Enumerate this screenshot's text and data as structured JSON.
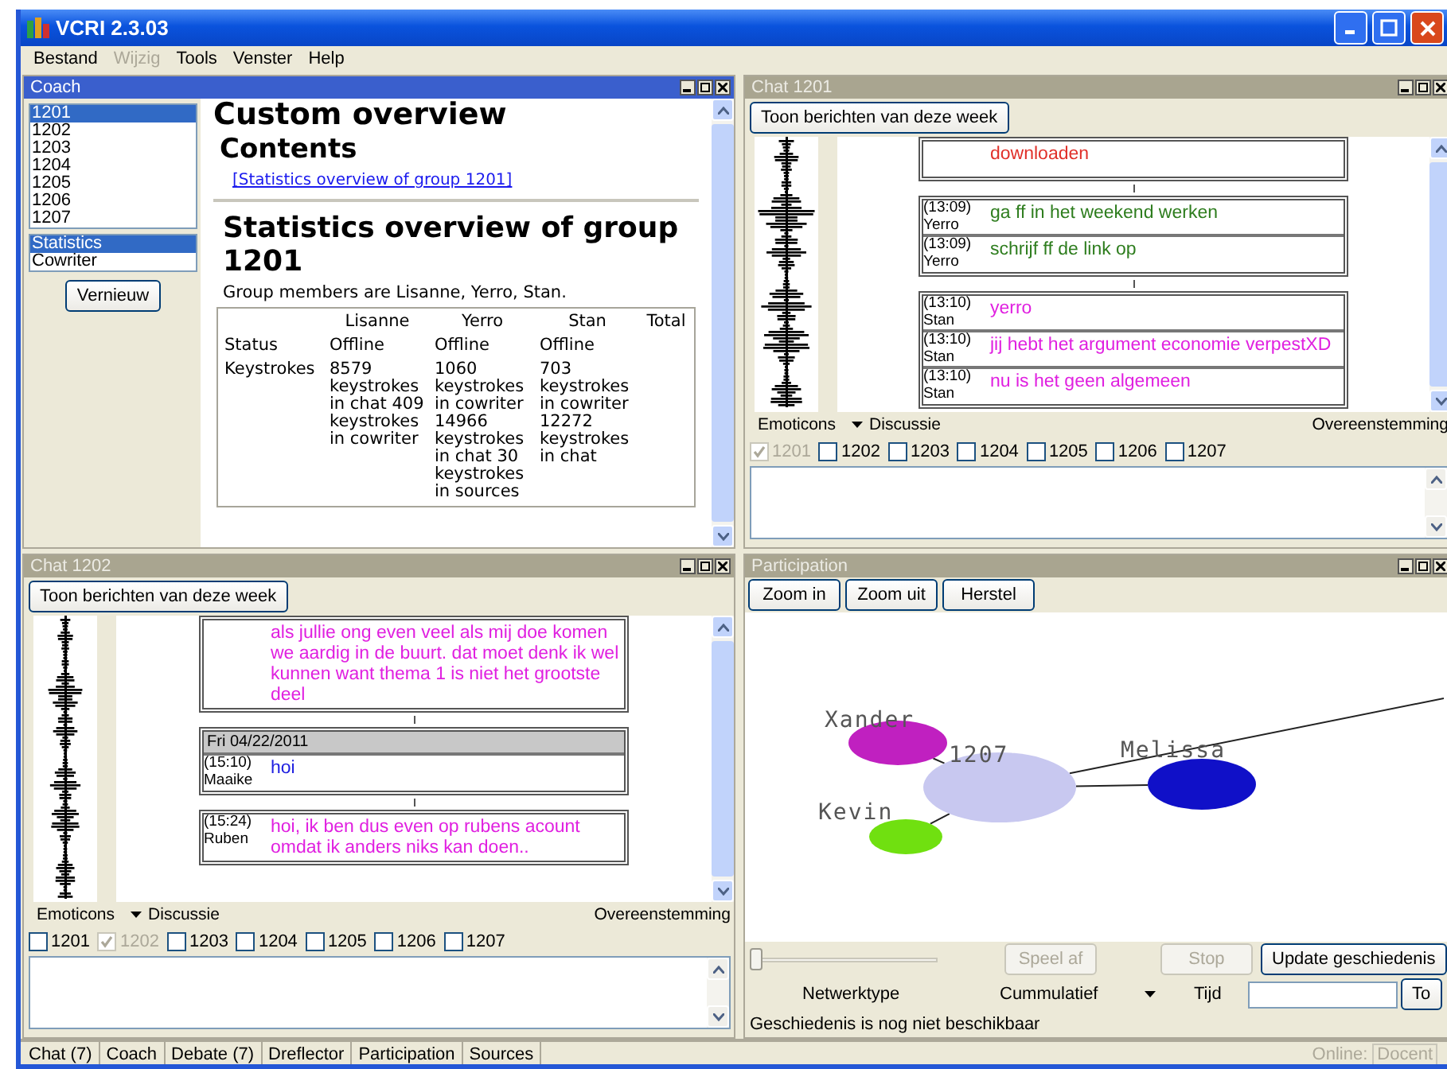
{
  "window": {
    "title": "VCRI 2.3.03"
  },
  "menu": [
    {
      "label": "Bestand",
      "disabled": false
    },
    {
      "label": "Wijzig",
      "disabled": true
    },
    {
      "label": "Tools",
      "disabled": false
    },
    {
      "label": "Venster",
      "disabled": false
    },
    {
      "label": "Help",
      "disabled": false
    }
  ],
  "coach": {
    "title": "Coach",
    "active": true,
    "groups": [
      {
        "label": "1201",
        "selected": true
      },
      {
        "label": "1202",
        "selected": false
      },
      {
        "label": "1203",
        "selected": false
      },
      {
        "label": "1204",
        "selected": false
      },
      {
        "label": "1205",
        "selected": false
      },
      {
        "label": "1206",
        "selected": false
      },
      {
        "label": "1207",
        "selected": false
      }
    ],
    "views": [
      {
        "label": "Statistics",
        "selected": true
      },
      {
        "label": "Cowriter",
        "selected": false
      }
    ],
    "refresh_button": "Vernieuw",
    "report": {
      "heading": "Custom overview",
      "contents_heading": "Contents",
      "link": "[Statistics overview of group 1201]",
      "section_heading": "Statistics overview of group 1201",
      "members": "Group members are Lisanne, Yerro, Stan.",
      "columns": [
        "Lisanne",
        "Yerro",
        "Stan",
        "Total"
      ],
      "rows": [
        {
          "label": "Status",
          "cells": [
            "Offline",
            "Offline",
            "Offline"
          ]
        },
        {
          "label": "Keystrokes",
          "cells": [
            "8579 keystrokes in chat 409 keystrokes in cowriter",
            "1060 keystrokes in cowriter 14966 keystrokes in chat 30 keystrokes in sources",
            "703 keystrokes in cowriter 12272 keystrokes in chat"
          ]
        }
      ]
    }
  },
  "chats": [
    {
      "title": "Chat 1201",
      "active": false,
      "week_button": "Toon berichten van deze week",
      "groups": [
        {
          "items": [
            {
              "text": "downloaden",
              "color": "#e0302a"
            }
          ]
        },
        {
          "items": [
            {
              "time": "(13:09)",
              "author": "Yerro",
              "text": "ga ff in het weekend werken",
              "color": "#2e7d1e"
            },
            {
              "time": "(13:09)",
              "author": "Yerro",
              "text": "schrijf ff de link op",
              "color": "#2e7d1e"
            }
          ]
        },
        {
          "items": [
            {
              "time": "(13:10)",
              "author": "Stan",
              "text": "yerro",
              "color": "#e020e0"
            },
            {
              "time": "(13:10)",
              "author": "Stan",
              "text": "jij hebt het argument economie verpestXD",
              "color": "#e020e0"
            },
            {
              "time": "(13:10)",
              "author": "Stan",
              "text": "nu is het geen algemeen",
              "color": "#e020e0"
            }
          ]
        }
      ],
      "emoticons": "Emoticons",
      "mode": "Discussie",
      "agreement": "Overeenstemming",
      "checks": [
        {
          "label": "1201",
          "checked": true,
          "disabled": true
        },
        {
          "label": "1202",
          "checked": false,
          "disabled": false
        },
        {
          "label": "1203",
          "checked": false,
          "disabled": false
        },
        {
          "label": "1204",
          "checked": false,
          "disabled": false
        },
        {
          "label": "1205",
          "checked": false,
          "disabled": false
        },
        {
          "label": "1206",
          "checked": false,
          "disabled": false
        },
        {
          "label": "1207",
          "checked": false,
          "disabled": false
        }
      ]
    },
    {
      "title": "Chat 1202",
      "active": false,
      "week_button": "Toon berichten van deze week",
      "groups": [
        {
          "items": [
            {
              "text": "als jullie ong even veel als mij doe komen we aardig in de buurt. dat moet denk ik wel kunnen want thema 1 is niet het grootste deel",
              "color": "#e020e0"
            }
          ]
        },
        {
          "date": "Fri 04/22/2011",
          "items": [
            {
              "time": "(15:10)",
              "author": "Maaike",
              "text": "hoi",
              "color": "#2020e0"
            }
          ]
        },
        {
          "items": [
            {
              "time": "(15:24)",
              "author": "Ruben",
              "text": "hoi, ik ben dus even op rubens acount omdat ik anders niks kan doen..",
              "color": "#e020e0"
            }
          ]
        }
      ],
      "emoticons": "Emoticons",
      "mode": "Discussie",
      "agreement": "Overeenstemming",
      "checks": [
        {
          "label": "1201",
          "checked": false,
          "disabled": false
        },
        {
          "label": "1202",
          "checked": true,
          "disabled": true
        },
        {
          "label": "1203",
          "checked": false,
          "disabled": false
        },
        {
          "label": "1204",
          "checked": false,
          "disabled": false
        },
        {
          "label": "1205",
          "checked": false,
          "disabled": false
        },
        {
          "label": "1206",
          "checked": false,
          "disabled": false
        },
        {
          "label": "1207",
          "checked": false,
          "disabled": false
        }
      ]
    }
  ],
  "participation": {
    "title": "Participation",
    "active": false,
    "buttons": [
      "Zoom in",
      "Zoom uit",
      "Herstel"
    ],
    "nodes": [
      {
        "label": "Xander",
        "color": "#c020c0",
        "kind": "member"
      },
      {
        "label": "1207",
        "color": "#c8c8f0",
        "kind": "group"
      },
      {
        "label": "Melissa",
        "color": "#1010c8",
        "kind": "member"
      },
      {
        "label": "Kevin",
        "color": "#70e010",
        "kind": "member"
      }
    ],
    "slider": {
      "level": 0
    },
    "play_button": {
      "label": "Speel af",
      "disabled": true
    },
    "stop_button": {
      "label": "Stop",
      "disabled": true
    },
    "update_button": {
      "label": "Update geschiedenis",
      "disabled": false
    },
    "network_type_label": "Netwerktype",
    "network_type": "Cummulatief",
    "time_label": "Tijd",
    "to_button": "To",
    "status": "Geschiedenis is nog niet beschikbaar"
  },
  "taskbar": {
    "tabs": [
      "Chat (7)",
      "Coach",
      "Debate (7)",
      "Dreflector",
      "Participation",
      "Sources"
    ],
    "online_label": "Online:",
    "online_value": "Docent"
  }
}
